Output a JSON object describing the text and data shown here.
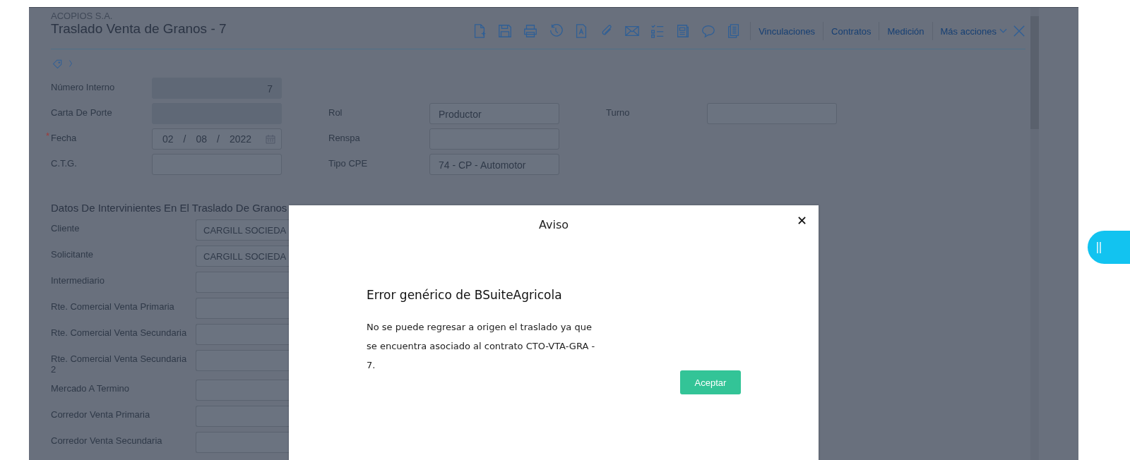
{
  "header": {
    "company": "ACOPIOS S.A.",
    "title": "Traslado Venta de Granos - 7"
  },
  "toolbar": {
    "icons": [
      {
        "kind": "new"
      },
      {
        "kind": "save"
      },
      {
        "kind": "print"
      },
      {
        "kind": "history"
      },
      {
        "kind": "text"
      },
      {
        "kind": "attach"
      },
      {
        "kind": "mail"
      },
      {
        "kind": "checklist"
      },
      {
        "kind": "document"
      },
      {
        "kind": "comment"
      },
      {
        "kind": "copies"
      }
    ],
    "links": [
      {
        "label": "Vinculaciones",
        "dropdown": false
      },
      {
        "label": "Contratos",
        "dropdown": false
      },
      {
        "label": "Medición",
        "dropdown": false
      },
      {
        "label": "Más acciones",
        "dropdown": true
      }
    ]
  },
  "form": {
    "rows": [
      {
        "left": {
          "label": "Número Interno",
          "value": "7",
          "kind": "readonly"
        }
      },
      {
        "left": {
          "label": "Carta De Porte",
          "kind": "readonly"
        },
        "middle": {
          "label": "Rol",
          "value": "Productor"
        },
        "right": {
          "label": "Turno"
        }
      },
      {
        "left": {
          "label": "Fecha",
          "required_mark": "*",
          "kind": "date",
          "day": "02",
          "month": "08",
          "year": "2022",
          "separator": "/"
        },
        "middle": {
          "label": "Renspa"
        }
      },
      {
        "left": {
          "label": "C.T.G."
        },
        "middle": {
          "label": "Tipo CPE",
          "value": "74 - CP - Automotor"
        }
      }
    ]
  },
  "section": {
    "title": "Datos De Intervinientes En El Traslado De Granos",
    "fields": [
      {
        "label": "Cliente",
        "value": "CARGILL SOCIEDA"
      },
      {
        "label": "Solicitante",
        "value": "CARGILL SOCIEDA"
      },
      {
        "label": "Intermediario"
      },
      {
        "label": "Rte. Comercial Venta Primaria"
      },
      {
        "label": "Rte. Comercial Venta Secundaria"
      },
      {
        "label": "Rte. Comercial Venta Secundaria 2"
      },
      {
        "label": "Mercado A Termino"
      },
      {
        "label": "Corredor Venta Primaria"
      },
      {
        "label": "Corredor Venta Secundaria"
      }
    ]
  },
  "dialog": {
    "title": "Aviso",
    "heading": "Error genérico de BSuiteAgricola",
    "message": "No se puede regresar a origen el traslado ya que se encuentra asociado al contrato CTO-VTA-GRA - 7.",
    "button": "Aceptar"
  }
}
